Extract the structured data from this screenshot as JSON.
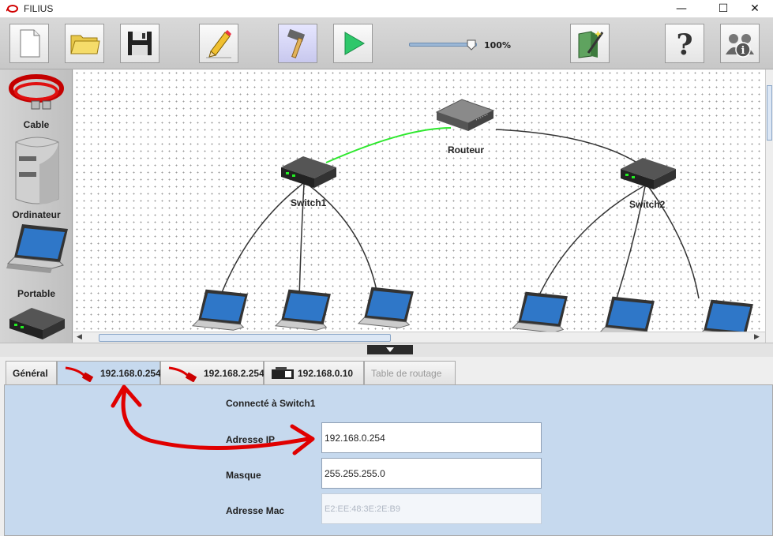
{
  "window": {
    "title": "FILIUS",
    "minimize": "—",
    "maximize": "☐",
    "close": "✕"
  },
  "toolbar": {
    "buttons": [
      {
        "icon": "new-file-icon"
      },
      {
        "icon": "open-folder-icon"
      },
      {
        "icon": "save-icon"
      },
      {
        "icon": "design-mode-pencil-icon"
      },
      {
        "icon": "simulation-mode-hammer-icon",
        "active": true
      },
      {
        "icon": "play-icon"
      },
      {
        "icon": "wizard-book-icon"
      },
      {
        "icon": "help-icon"
      },
      {
        "icon": "about-info-icon"
      }
    ],
    "zoom": {
      "label": "100%",
      "level_fraction": 0.92
    }
  },
  "palette": {
    "items": [
      {
        "label": "Cable",
        "icon": "cable-icon"
      },
      {
        "label": "Ordinateur",
        "icon": "computer-icon"
      },
      {
        "label": "Portable",
        "icon": "laptop-icon"
      },
      {
        "label": "",
        "icon": "switch-icon"
      }
    ]
  },
  "network": {
    "nodes": {
      "router": {
        "label": "Routeur"
      },
      "switch1": {
        "label": "Switch1"
      },
      "switch2": {
        "label": "Switch2"
      }
    }
  },
  "tabs": [
    {
      "label": "Général"
    },
    {
      "label": "192.168.0.254",
      "icon": "cable-icon",
      "selected": true
    },
    {
      "label": "192.168.2.254",
      "icon": "cable-icon"
    },
    {
      "label": "192.168.0.10",
      "icon": "switch-icon"
    },
    {
      "label": "Table de routage",
      "disabled": true
    }
  ],
  "panel": {
    "connected": "Connecté à Switch1",
    "ip_label": "Adresse IP",
    "ip_value": "192.168.0.254",
    "mask_label": "Masque",
    "mask_value": "255.255.255.0",
    "mac_label": "Adresse Mac",
    "mac_value": "E2:EE:48:3E:2E:B9"
  },
  "colors": {
    "annotation_arrow": "#e00000",
    "active_link": "#2ee82e",
    "panel_bg": "#c6d9ee"
  }
}
